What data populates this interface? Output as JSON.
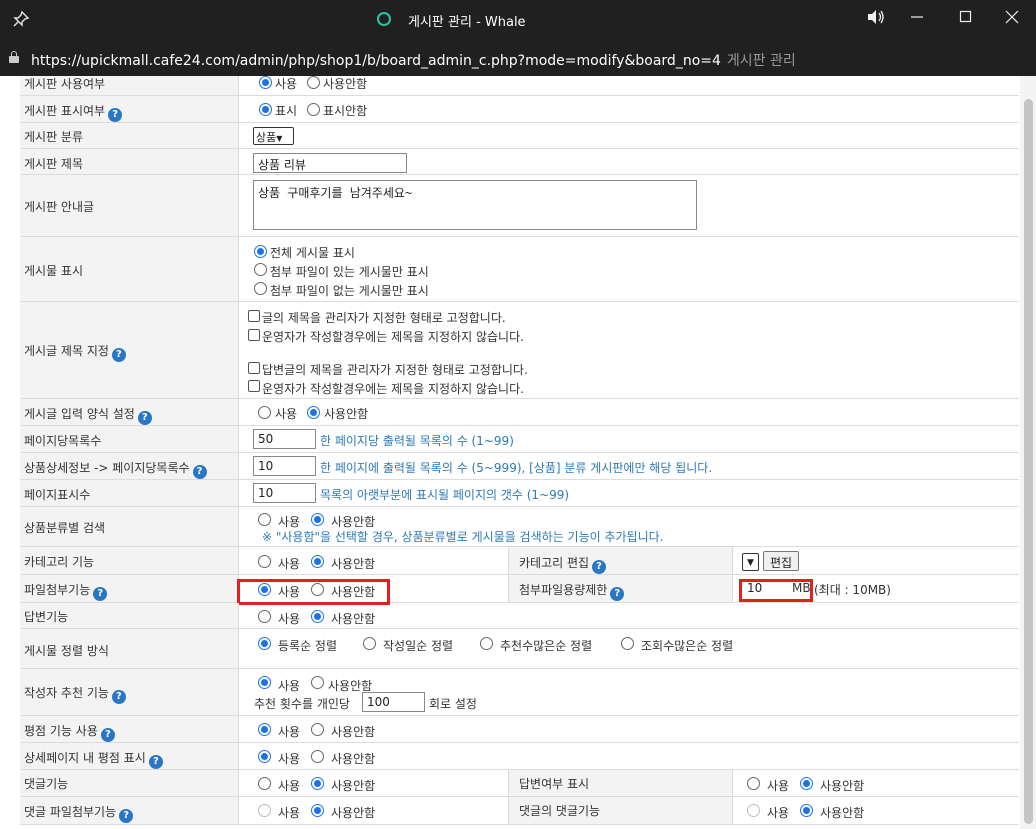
{
  "window": {
    "title": "게시판 관리 - Whale",
    "url": "https://upickmall.cafe24.com/admin/php/shop1/b/board_admin_c.php?mode=modify&board_no=4",
    "page_title": "게시판 관리",
    "accent": "#29c3a3"
  },
  "rows": {
    "use": {
      "label": "게시판 사용여부",
      "opt1": "사용",
      "opt2": "사용안함"
    },
    "display": {
      "label": "게시판 표시여부",
      "opt1": "표시",
      "opt2": "표시안함"
    },
    "category": {
      "label": "게시판 분류",
      "selected": "상품"
    },
    "title": {
      "label": "게시판 제목",
      "value": "상품 리뷰"
    },
    "guide": {
      "label": "게시판 안내글",
      "value": "상품 구매후기를 남겨주세요~"
    },
    "post_display": {
      "label": "게시물 표시",
      "opt1": "전체 게시물 표시",
      "opt2": "첨부 파일이 있는 게시물만 표시",
      "opt3": "첨부 파일이 없는 게시물만 표시"
    },
    "post_title": {
      "label": "게시글 제목 지정",
      "cb1": "글의 제목을 관리자가 지정한 형태로 고정합니다.",
      "cb2": "운영자가 작성할경우에는 제목을 지정하지 않습니다.",
      "cb3": "답변글의 제목을 관리자가 지정한 형태로 고정합니다.",
      "cb4": "운영자가 작성할경우에는 제목을 지정하지 않습니다."
    },
    "input_form": {
      "label": "게시글 입력 양식 설정",
      "opt1": "사용",
      "opt2": "사용안함"
    },
    "per_page": {
      "label": "페이지당목록수",
      "value": "50",
      "help": "한 페이지당 출력될 목록의 수 (1~99)"
    },
    "product_per_page": {
      "label": "상품상세정보 -> 페이지당목록수",
      "value": "10",
      "help": "한 페이지에 출력될 목록의 수 (5~999), [상품] 분류 게시판에만 해당 됩니다."
    },
    "page_count": {
      "label": "페이지표시수",
      "value": "10",
      "help": "목록의 아랫부분에 표시될 페이지의 갯수 (1~99)"
    },
    "product_cat_search": {
      "label": "상품분류별 검색",
      "opt1": "사용",
      "opt2": "사용안함",
      "note": "※ \"사용함\"을 선택할 경우, 상품분류별로 게시물을 검색하는 기능이 추가됩니다."
    },
    "cat_feature": {
      "label": "카테고리 기능",
      "opt1": "사용",
      "opt2": "사용안함",
      "label2": "카테고리 편집",
      "edit_btn": "편집"
    },
    "attach": {
      "label": "파일첨부기능",
      "opt1": "사용",
      "opt2": "사용안함",
      "label2": "첨부파일용량제한",
      "size_value": "10",
      "unit": "MB",
      "max": "(최대 : 10MB)"
    },
    "reply": {
      "label": "답변기능",
      "opt1": "사용",
      "opt2": "사용안함"
    },
    "sort": {
      "label": "게시물 정렬 방식",
      "opt1": "등록순 정렬",
      "opt2": "작성일순 정렬",
      "opt3": "추천수많은순 정렬",
      "opt4": "조회수많은순 정렬"
    },
    "recommend": {
      "label": "작성자 추천 기능",
      "opt1": "사용",
      "opt2": "사용안함",
      "prefix": "추천 횟수를 개인당",
      "value": "100",
      "suffix": "회로 설정"
    },
    "rating": {
      "label": "평점 기능 사용",
      "opt1": "사용",
      "opt2": "사용안함"
    },
    "detail_rating": {
      "label": "상세페이지 내 평점 표시",
      "opt1": "사용",
      "opt2": "사용안함"
    },
    "comment": {
      "label": "댓글기능",
      "opt1": "사용",
      "opt2": "사용안함",
      "label2": "답변여부 표시",
      "opt3": "사용",
      "opt4": "사용안함"
    },
    "comment_attach": {
      "label": "댓글 파일첨부기능",
      "opt1": "사용",
      "opt2": "사용안함",
      "label2": "댓글의 댓글기능",
      "opt3": "사용",
      "opt4": "사용안함"
    }
  }
}
